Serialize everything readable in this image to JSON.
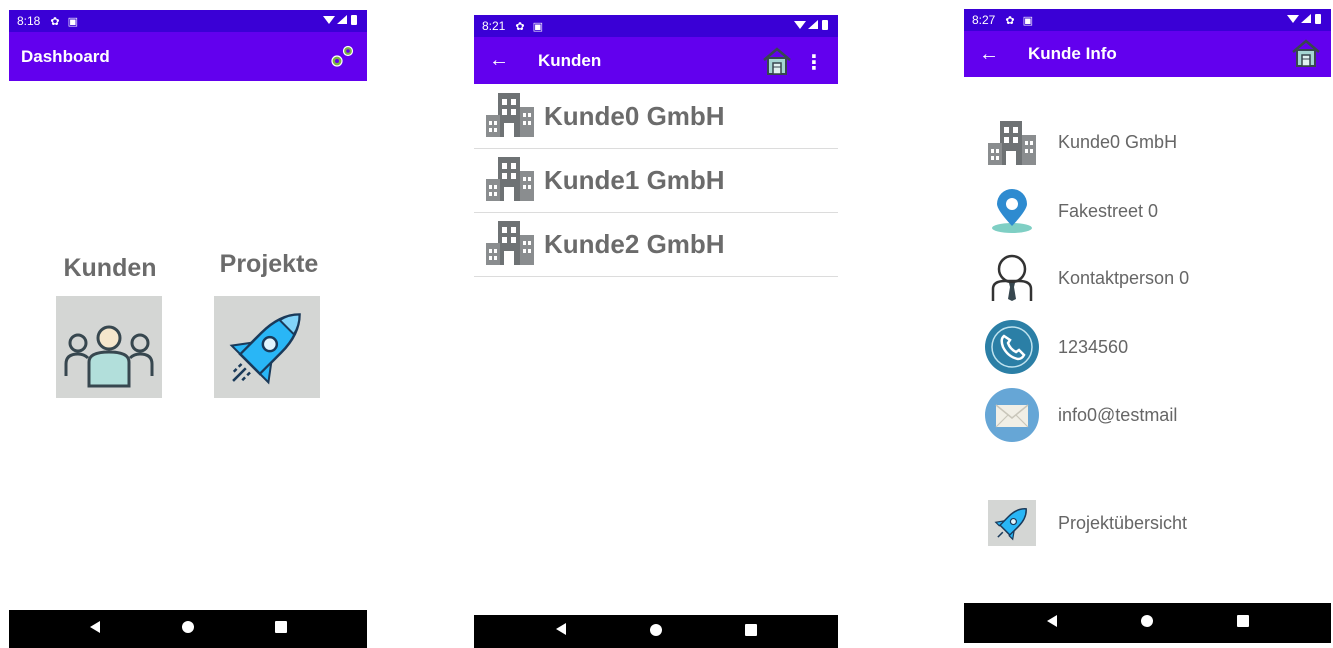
{
  "screens": {
    "dashboard": {
      "status_time": "8:18",
      "title": "Dashboard",
      "tiles": [
        {
          "label": "Kunden",
          "icon": "people-icon"
        },
        {
          "label": "Projekte",
          "icon": "rocket-icon"
        }
      ]
    },
    "kunden": {
      "status_time": "8:21",
      "title": "Kunden",
      "customers": [
        "Kunde0 GmbH",
        "Kunde1 GmbH",
        "Kunde2 GmbH"
      ]
    },
    "kunde_info": {
      "status_time": "8:27",
      "title": "Kunde Info",
      "company": "Kunde0 GmbH",
      "street": "Fakestreet 0",
      "contact": "Kontaktperson 0",
      "phone": "1234560",
      "email": "info0@testmail",
      "projects_link": "Projektübersicht"
    }
  },
  "colors": {
    "status_bar": "#3a00d6",
    "app_bar": "#6200ee",
    "nav_bar": "#000000",
    "text_gray": "#6b6b6b",
    "tile_bg": "#d4d6d4"
  }
}
